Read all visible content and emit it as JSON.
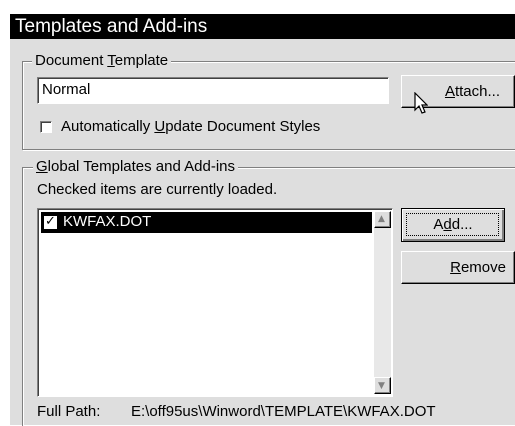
{
  "dialog": {
    "title": "Templates and Add-ins"
  },
  "document_template": {
    "group_label_prefix": "Document ",
    "group_label_hotkey": "T",
    "group_label_suffix": "emplate",
    "value": "Normal",
    "attach_button": {
      "prefix": "",
      "hotkey": "A",
      "suffix": "ttach..."
    },
    "auto_update": {
      "checked": false,
      "prefix": "Automatically ",
      "hotkey": "U",
      "suffix": "pdate Document Styles"
    }
  },
  "global_templates": {
    "group_label_prefix": "",
    "group_label_hotkey": "G",
    "group_label_suffix": "lobal Templates and Add-ins",
    "note": "Checked items are currently loaded.",
    "items": [
      {
        "label": "KWFAX.DOT",
        "checked": true,
        "selected": true
      }
    ],
    "add_button": {
      "prefix": "A",
      "hotkey": "d",
      "suffix": "d..."
    },
    "remove_button": {
      "prefix": "",
      "hotkey": "R",
      "suffix": "emove"
    },
    "full_path_label": "Full Path:",
    "full_path_value": "E:\\off95us\\Winword\\TEMPLATE\\KWFAX.DOT"
  },
  "icons": {
    "checkmark": "✓",
    "scroll_up": "▲",
    "scroll_down": "▼"
  },
  "colors": {
    "titlebar": "#000000",
    "face": "#dedede",
    "selection": "#000000"
  }
}
